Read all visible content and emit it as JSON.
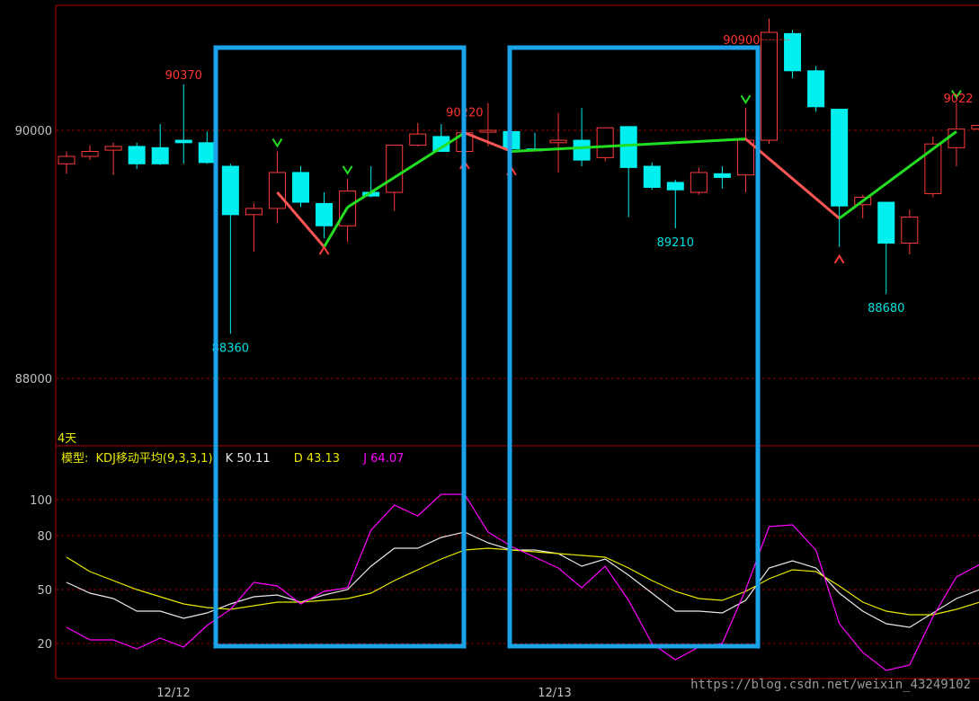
{
  "header": {
    "left_fragment": "",
    "right_fragment": ""
  },
  "period_label": "4天",
  "indicator": {
    "prefix": "模型:",
    "name": "KDJ移动平均(9,3,3,1)",
    "k_label": "K 50.11",
    "d_label": "D 43.13",
    "j_label": "J 64.07"
  },
  "dates": [
    "12/12",
    "12/13"
  ],
  "watermark": "https://blog.csdn.net/weixin_43249102",
  "colors": {
    "up": "#ff3b3b",
    "down": "#00f0f0",
    "grid": "#8b0000",
    "panel_border": "#b00000",
    "axis_text": "#c0c0c0",
    "k": "#e8e8e8",
    "d": "#e8e800",
    "j": "#ff00ff",
    "zigzag_up": "#ff5555",
    "zigzag_down": "#22dd22",
    "highlight": "#1aa3e8",
    "high_label": "#ff3333",
    "low_label": "#00e0e0"
  },
  "chart_data": [
    {
      "type": "candlestick",
      "y_ticks": [
        90000,
        88000
      ],
      "ylim": [
        87500,
        90950
      ],
      "annotations": [
        {
          "text": "90370",
          "kind": "high",
          "index": 5
        },
        {
          "text": "88360",
          "kind": "low",
          "index": 7
        },
        {
          "text": "90220",
          "kind": "high",
          "index": 17
        },
        {
          "text": "89210",
          "kind": "low",
          "index": 26
        },
        {
          "text": "90900",
          "kind": "high",
          "index": 31
        },
        {
          "text": "88680",
          "kind": "low",
          "index": 35
        },
        {
          "text": "9022",
          "kind": "high",
          "index": 39
        }
      ],
      "candles": [
        {
          "o": 89730,
          "h": 89830,
          "l": 89650,
          "c": 89790
        },
        {
          "o": 89790,
          "h": 89880,
          "l": 89760,
          "c": 89830
        },
        {
          "o": 89840,
          "h": 89900,
          "l": 89640,
          "c": 89870
        },
        {
          "o": 89870,
          "h": 89900,
          "l": 89690,
          "c": 89730
        },
        {
          "o": 89860,
          "h": 90050,
          "l": 89720,
          "c": 89730
        },
        {
          "o": 89920,
          "h": 90370,
          "l": 89730,
          "c": 89900
        },
        {
          "o": 89900,
          "h": 89990,
          "l": 89730,
          "c": 89740
        },
        {
          "o": 89710,
          "h": 89730,
          "l": 88360,
          "c": 89320
        },
        {
          "o": 89320,
          "h": 89410,
          "l": 89020,
          "c": 89370
        },
        {
          "o": 89370,
          "h": 89830,
          "l": 89250,
          "c": 89660
        },
        {
          "o": 89660,
          "h": 89710,
          "l": 89380,
          "c": 89420
        },
        {
          "o": 89410,
          "h": 89500,
          "l": 89130,
          "c": 89230
        },
        {
          "o": 89230,
          "h": 89610,
          "l": 89100,
          "c": 89510
        },
        {
          "o": 89500,
          "h": 89710,
          "l": 89460,
          "c": 89470
        },
        {
          "o": 89500,
          "h": 89880,
          "l": 89350,
          "c": 89880
        },
        {
          "o": 89880,
          "h": 90060,
          "l": 89870,
          "c": 89970
        },
        {
          "o": 89950,
          "h": 90050,
          "l": 89830,
          "c": 89830
        },
        {
          "o": 89830,
          "h": 90070,
          "l": 89820,
          "c": 89980
        },
        {
          "o": 90000,
          "h": 90220,
          "l": 89870,
          "c": 90000
        },
        {
          "o": 89990,
          "h": 90220,
          "l": 89770,
          "c": 89850
        },
        {
          "o": 89850,
          "h": 89980,
          "l": 89830,
          "c": 89840
        },
        {
          "o": 89900,
          "h": 90140,
          "l": 89660,
          "c": 89920
        },
        {
          "o": 89920,
          "h": 90180,
          "l": 89710,
          "c": 89760
        },
        {
          "o": 89780,
          "h": 90020,
          "l": 89750,
          "c": 90020
        },
        {
          "o": 90030,
          "h": 90030,
          "l": 89300,
          "c": 89700
        },
        {
          "o": 89710,
          "h": 89740,
          "l": 89520,
          "c": 89540
        },
        {
          "o": 89580,
          "h": 89600,
          "l": 89210,
          "c": 89520
        },
        {
          "o": 89500,
          "h": 89700,
          "l": 89480,
          "c": 89660
        },
        {
          "o": 89650,
          "h": 89710,
          "l": 89530,
          "c": 89620
        },
        {
          "o": 89640,
          "h": 90180,
          "l": 89500,
          "c": 89920
        },
        {
          "o": 89920,
          "h": 90900,
          "l": 89890,
          "c": 90790
        },
        {
          "o": 90780,
          "h": 90810,
          "l": 90420,
          "c": 90480
        },
        {
          "o": 90480,
          "h": 90520,
          "l": 90150,
          "c": 90190
        },
        {
          "o": 90170,
          "h": 90170,
          "l": 89060,
          "c": 89390
        },
        {
          "o": 89400,
          "h": 89480,
          "l": 89290,
          "c": 89460
        },
        {
          "o": 89420,
          "h": 89420,
          "l": 88680,
          "c": 89090
        },
        {
          "o": 89090,
          "h": 89360,
          "l": 89000,
          "c": 89300
        },
        {
          "o": 89490,
          "h": 89950,
          "l": 89460,
          "c": 89890
        },
        {
          "o": 89860,
          "h": 90220,
          "l": 89710,
          "c": 90010
        },
        {
          "o": 90010,
          "h": 90180,
          "l": 90000,
          "c": 90040
        }
      ],
      "signals": [
        {
          "index": 9,
          "dir": "buy"
        },
        {
          "index": 11,
          "dir": "sell"
        },
        {
          "index": 12,
          "dir": "buy"
        },
        {
          "index": 17,
          "dir": "sell"
        },
        {
          "index": 19,
          "dir": "sell"
        },
        {
          "index": 29,
          "dir": "buy"
        },
        {
          "index": 33,
          "dir": "sell"
        },
        {
          "index": 38,
          "dir": "buy"
        }
      ],
      "zigzag": [
        {
          "index": 9,
          "price": 89500
        },
        {
          "index": 11,
          "price": 89060
        },
        {
          "index": 12,
          "price": 89380
        },
        {
          "index": 17,
          "price": 89980
        },
        {
          "index": 19,
          "price": 89830
        },
        {
          "index": 29,
          "price": 89930
        },
        {
          "index": 33,
          "price": 89290
        },
        {
          "index": 38,
          "price": 89990
        }
      ]
    },
    {
      "type": "line",
      "title": "KDJ移动平均(9,3,3,1)",
      "y_ticks": [
        100,
        80,
        50,
        20
      ],
      "ylim": [
        10,
        110
      ],
      "series": [
        {
          "name": "K",
          "values": [
            54,
            48,
            45,
            38,
            38,
            34,
            37,
            42,
            46,
            47,
            43,
            47,
            50,
            63,
            73,
            73,
            79,
            82,
            76,
            72,
            72,
            70,
            63,
            67,
            58,
            48,
            38,
            38,
            37,
            44,
            62,
            66,
            62,
            48,
            38,
            31,
            29,
            37,
            45,
            50
          ]
        },
        {
          "name": "D",
          "values": [
            68,
            60,
            55,
            50,
            46,
            42,
            40,
            39,
            41,
            43,
            43,
            44,
            45,
            48,
            55,
            61,
            67,
            72,
            73,
            72,
            71,
            70,
            69,
            68,
            62,
            55,
            49,
            45,
            44,
            49,
            56,
            61,
            60,
            52,
            43,
            38,
            36,
            36,
            39,
            43
          ]
        },
        {
          "name": "J",
          "values": [
            29,
            22,
            22,
            17,
            23,
            18,
            30,
            39,
            54,
            52,
            42,
            49,
            51,
            83,
            97,
            91,
            103,
            103,
            82,
            74,
            68,
            62,
            51,
            63,
            44,
            20,
            11,
            18,
            20,
            50,
            85,
            86,
            72,
            31,
            15,
            5,
            8,
            35,
            57,
            64
          ]
        }
      ]
    }
  ]
}
